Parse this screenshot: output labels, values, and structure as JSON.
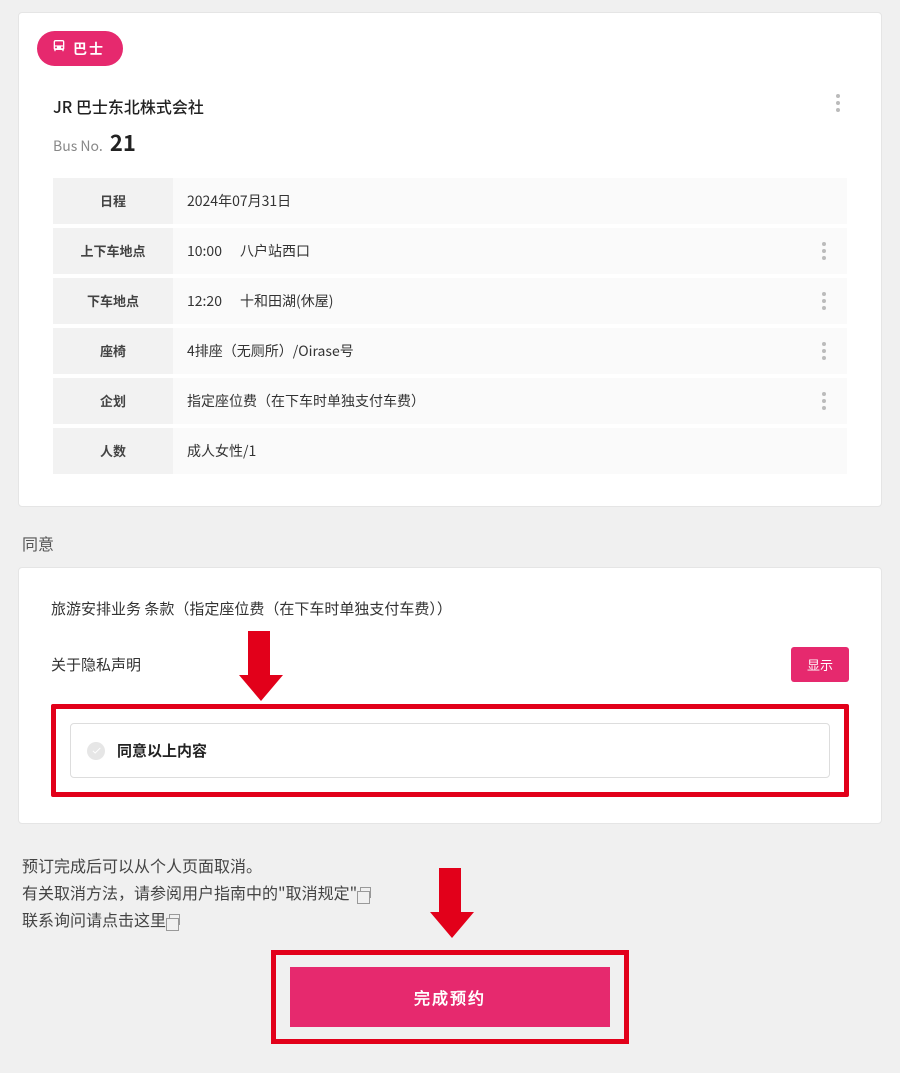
{
  "badge": {
    "label": "巴士"
  },
  "operator": "JR 巴士东北株式会社",
  "bus_no_prefix": "Bus No.",
  "bus_no": "21",
  "details": {
    "schedule": {
      "label": "日程",
      "value": "2024年07月31日"
    },
    "boarding": {
      "label": "上下车地点",
      "time": "10:00",
      "place": "八户站西口"
    },
    "alighting": {
      "label": "下车地点",
      "time": "12:20",
      "place": "十和田湖(休屋)"
    },
    "seat": {
      "label": "座椅",
      "value": "4排座（无厕所）/Oirase号"
    },
    "plan": {
      "label": "企划",
      "value": "指定座位费（在下车时单独支付车费）"
    },
    "pax": {
      "label": "人数",
      "value": "成人女性/1"
    }
  },
  "agree": {
    "title": "同意",
    "terms_line": "旅游安排业务 条款（指定座位费（在下车时单独支付车费））",
    "privacy_line": "关于隐私声明",
    "show_button": "显示",
    "checkbox_label": "同意以上内容"
  },
  "notice": {
    "line1": "预订完成后可以从个人页面取消。",
    "line2a": "有关取消方法，请参阅用户指南中的",
    "line2b": "\"取消规定\"",
    "line3a": "联系询问请",
    "line3b": "点击这里"
  },
  "complete_button": "完成预约",
  "colors": {
    "accent": "#e6296e",
    "highlight": "#e2001a"
  }
}
